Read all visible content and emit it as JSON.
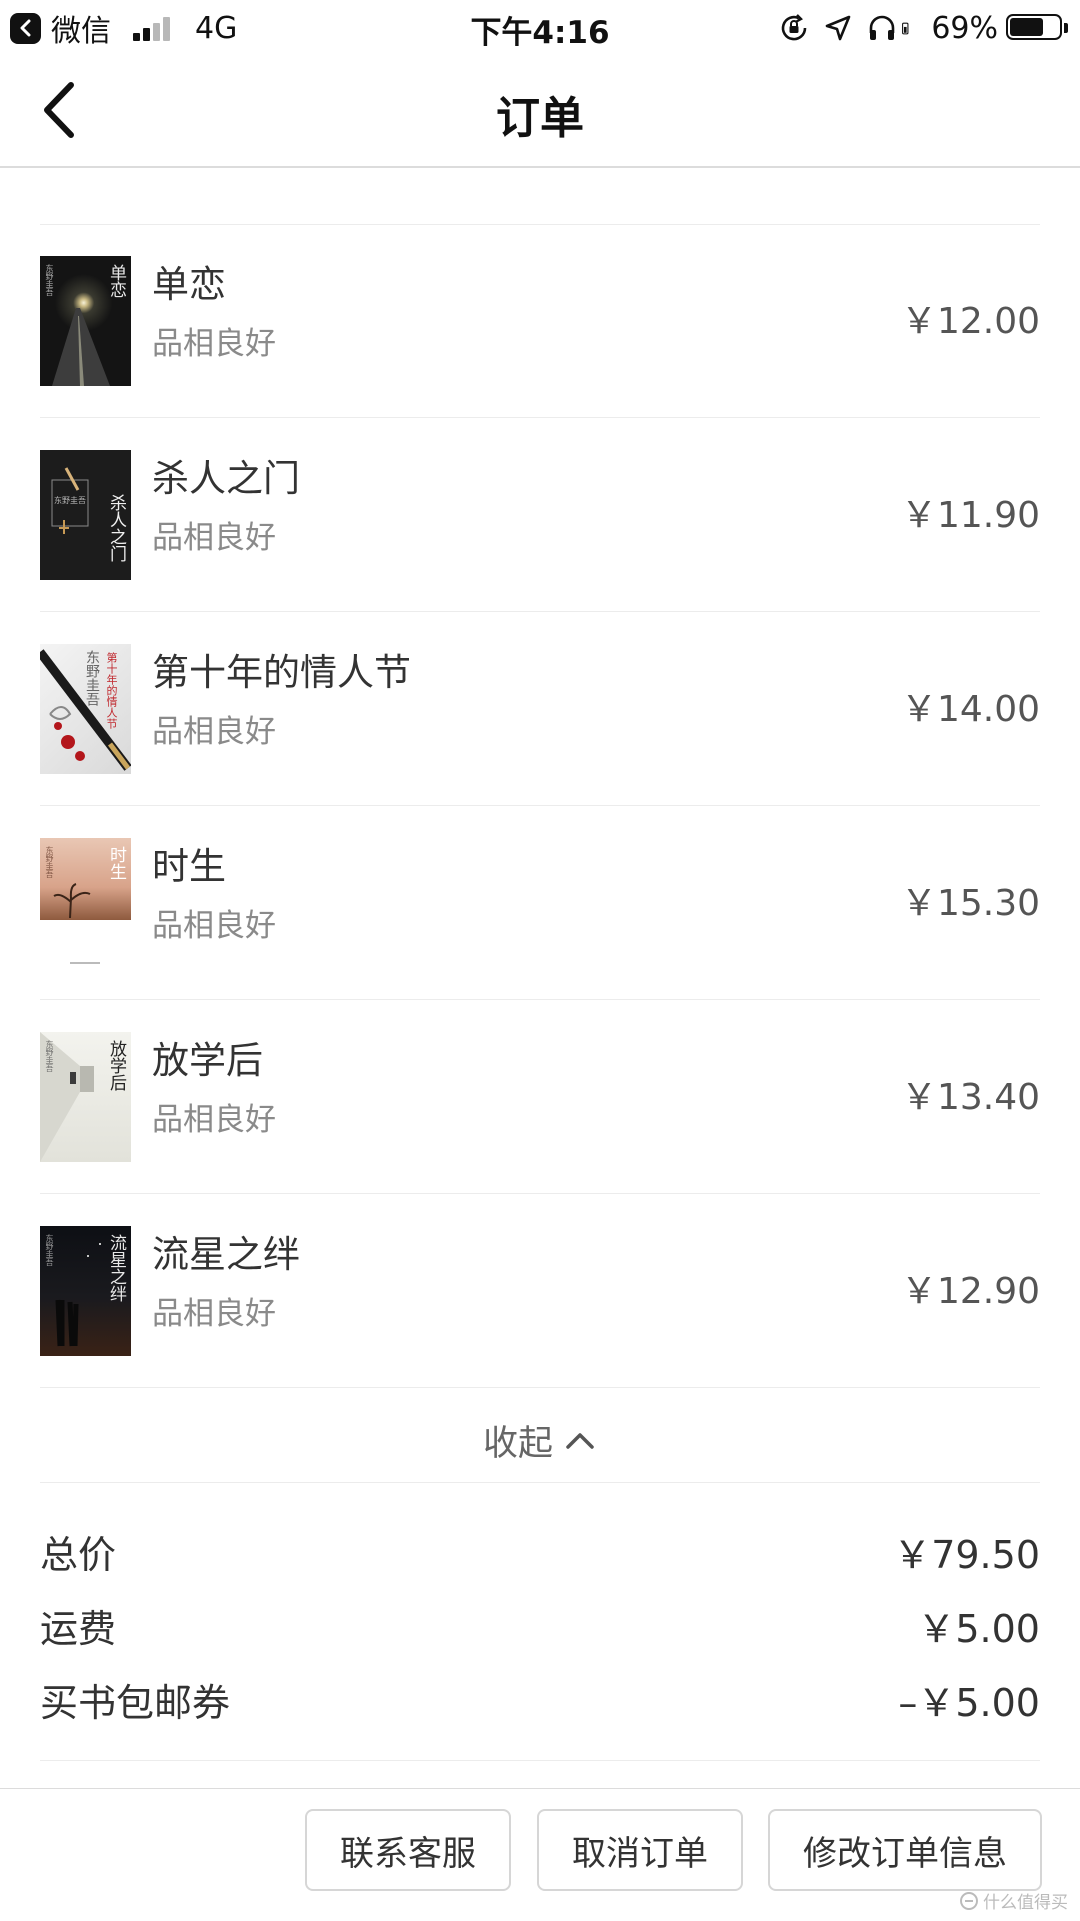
{
  "status_bar": {
    "app": "微信",
    "network": "4G",
    "time": "下午4:16",
    "battery": "69%",
    "battery_level": 0.69
  },
  "nav": {
    "title": "订单"
  },
  "items": [
    {
      "title": "单恋",
      "condition": "品相良好",
      "price": "￥12.00",
      "cover_title": "单恋",
      "cover_author": "东野圭吾"
    },
    {
      "title": "杀人之门",
      "condition": "品相良好",
      "price": "￥11.90",
      "cover_title": "杀人之门",
      "cover_author": "东野圭吾"
    },
    {
      "title": "第十年的情人节",
      "condition": "品相良好",
      "price": "￥14.00",
      "cover_title": "第十年的情人节",
      "cover_author": "东野圭吾"
    },
    {
      "title": "时生",
      "condition": "品相良好",
      "price": "￥15.30",
      "cover_title": "时生",
      "cover_author": "东野圭吾"
    },
    {
      "title": "放学后",
      "condition": "品相良好",
      "price": "￥13.40",
      "cover_title": "放学后",
      "cover_author": "东野圭吾"
    },
    {
      "title": "流星之绊",
      "condition": "品相良好",
      "price": "￥12.90",
      "cover_title": "流星之绊",
      "cover_author": "东野圭吾"
    }
  ],
  "collapse_label": "收起",
  "summary": {
    "total_label": "总价",
    "total_value": "￥79.50",
    "shipping_label": "运费",
    "shipping_value": "￥5.00",
    "coupon_label": "买书包邮券",
    "coupon_value": "–￥5.00"
  },
  "buttons": {
    "contact": "联系客服",
    "cancel": "取消订单",
    "modify": "修改订单信息"
  },
  "watermark": "什么值得买",
  "colors": {
    "text": "#333333",
    "muted": "#8a8a8a",
    "divider": "#ececec",
    "button_border": "#d6d6d6"
  }
}
